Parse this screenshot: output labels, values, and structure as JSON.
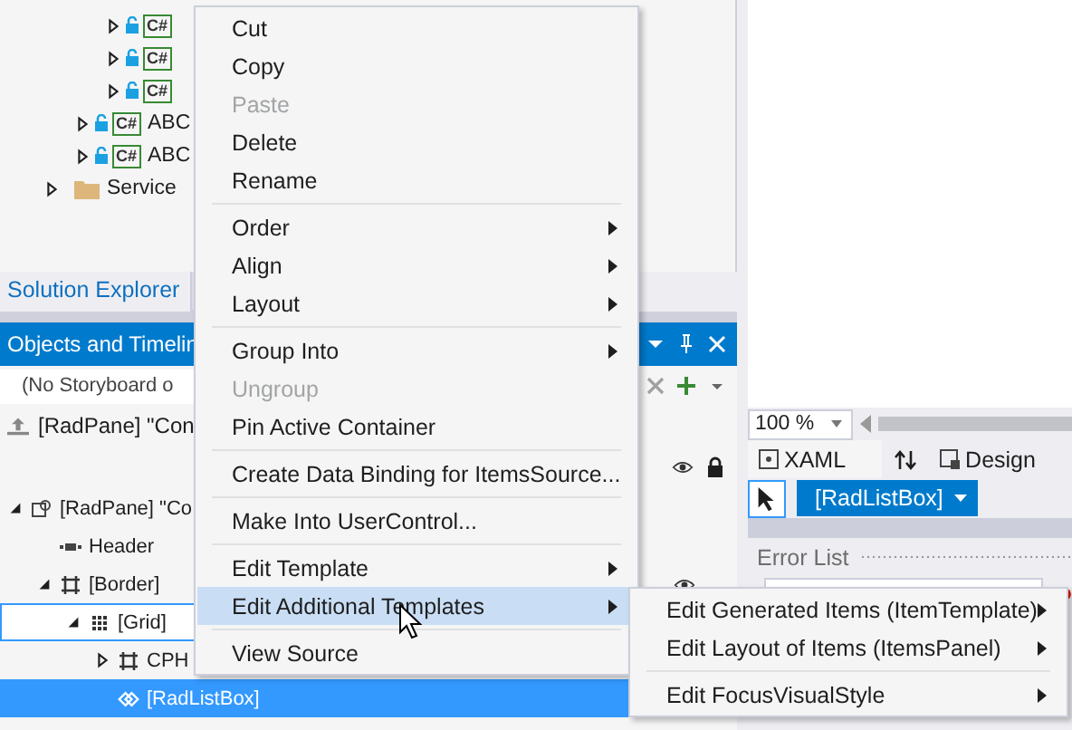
{
  "solution_explorer": {
    "tree": [
      {
        "children": [
          {
            "children": [
              {
                "kind": "class",
                "badge": "C#",
                "expanded": false
              },
              {
                "kind": "class",
                "badge": "C#",
                "expanded": false
              },
              {
                "kind": "class",
                "badge": "C#",
                "expanded": false
              }
            ]
          },
          {
            "kind": "class",
            "badge": "C#",
            "label": "ABC",
            "expanded": false
          },
          {
            "kind": "class",
            "badge": "C#",
            "label": "ABC",
            "expanded": false
          }
        ]
      },
      {
        "kind": "folder",
        "label": "Service",
        "expanded": false
      }
    ]
  },
  "panel_tabs": [
    {
      "label": "Solution Explorer",
      "selected": true
    },
    {
      "selected": false
    }
  ],
  "objects_panel": {
    "title": "Objects and Timelin",
    "storyboard": "(No Storyboard o",
    "scope": "[RadPane] \"Con",
    "tree": [
      {
        "label": "[RadPane] \"Co",
        "kind": "pane",
        "expanded": true,
        "selected": false,
        "focused": false,
        "children": [
          {
            "label": "Header",
            "kind": "header",
            "selected": false,
            "focused": false
          },
          {
            "label": "[Border]",
            "kind": "border",
            "expanded": true,
            "selected": false,
            "focused": false,
            "eye": true,
            "children": [
              {
                "label": "[Grid]",
                "kind": "grid",
                "expanded": true,
                "selected": false,
                "focused": true,
                "children": [
                  {
                    "label": "CPH",
                    "kind": "border",
                    "expanded": false,
                    "selected": false,
                    "focused": false
                  },
                  {
                    "label": "[RadListBox]",
                    "kind": "list",
                    "selected": true,
                    "focused": false
                  }
                ]
              }
            ]
          }
        ]
      }
    ]
  },
  "editor": {
    "zoom": "100 %",
    "tabs": [
      {
        "label": "XAML",
        "kind": "xaml",
        "selected": true
      },
      {
        "label": "Design",
        "kind": "design",
        "selected": false
      }
    ],
    "element_picker": "[RadListBox]",
    "error_list": {
      "title": "Error List"
    }
  },
  "context_menu": {
    "items": [
      {
        "kind": "item",
        "label": "Cut",
        "disabled": false,
        "submenu": false,
        "selected": false
      },
      {
        "kind": "item",
        "label": "Copy",
        "disabled": false,
        "submenu": false,
        "selected": false
      },
      {
        "kind": "item",
        "label": "Paste",
        "disabled": true,
        "submenu": false,
        "selected": false
      },
      {
        "kind": "item",
        "label": "Delete",
        "disabled": false,
        "submenu": false,
        "selected": false
      },
      {
        "kind": "item",
        "label": "Rename",
        "disabled": false,
        "submenu": false,
        "selected": false
      },
      {
        "kind": "separator"
      },
      {
        "kind": "item",
        "label": "Order",
        "disabled": false,
        "submenu": true,
        "selected": false
      },
      {
        "kind": "item",
        "label": "Align",
        "disabled": false,
        "submenu": true,
        "selected": false
      },
      {
        "kind": "item",
        "label": "Layout",
        "disabled": false,
        "submenu": true,
        "selected": false
      },
      {
        "kind": "separator"
      },
      {
        "kind": "item",
        "label": "Group Into",
        "disabled": false,
        "submenu": true,
        "selected": false
      },
      {
        "kind": "item",
        "label": "Ungroup",
        "disabled": true,
        "submenu": false,
        "selected": false
      },
      {
        "kind": "item",
        "label": "Pin Active Container",
        "disabled": false,
        "submenu": false,
        "selected": false
      },
      {
        "kind": "separator"
      },
      {
        "kind": "item",
        "label": "Create Data Binding for ItemsSource...",
        "disabled": false,
        "submenu": false,
        "selected": false
      },
      {
        "kind": "separator"
      },
      {
        "kind": "item",
        "label": "Make Into UserControl...",
        "disabled": false,
        "submenu": false,
        "selected": false
      },
      {
        "kind": "separator"
      },
      {
        "kind": "item",
        "label": "Edit Template",
        "disabled": false,
        "submenu": true,
        "selected": false
      },
      {
        "kind": "item",
        "label": "Edit Additional Templates",
        "disabled": false,
        "submenu": true,
        "selected": true
      },
      {
        "kind": "separator"
      },
      {
        "kind": "item",
        "label": "View Source",
        "disabled": false,
        "submenu": false,
        "selected": false
      }
    ]
  },
  "submenu": {
    "items": [
      {
        "kind": "item",
        "label": "Edit Generated Items (ItemTemplate)",
        "disabled": false,
        "submenu": true,
        "selected": false
      },
      {
        "kind": "item",
        "label": "Edit Layout of Items (ItemsPanel)",
        "disabled": false,
        "submenu": true,
        "selected": false
      },
      {
        "kind": "separator"
      },
      {
        "kind": "item",
        "label": "Edit FocusVisualStyle",
        "disabled": false,
        "submenu": true,
        "selected": false
      }
    ]
  }
}
